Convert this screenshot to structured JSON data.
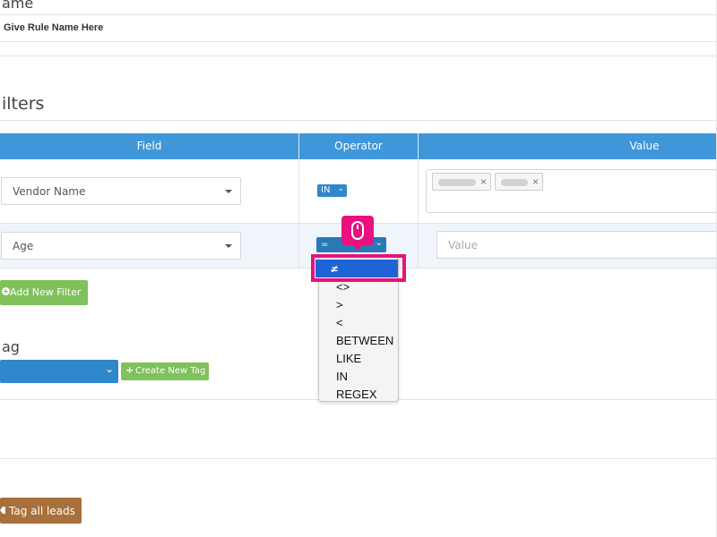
{
  "rule_name": {
    "section_label": "ame",
    "input_value": "Give Rule Name Here"
  },
  "filters": {
    "section_label": "ilters",
    "columns": [
      "Field",
      "Operator",
      "Value"
    ],
    "rows": [
      {
        "field": "Vendor Name",
        "operator": "IN"
      },
      {
        "field": "Age",
        "operator": "=",
        "value_placeholder": "Value"
      }
    ],
    "add_filter_label": "Add New Filter"
  },
  "operator_dropdown": {
    "selected": "=",
    "options": [
      "<>",
      ">",
      "<",
      "BETWEEN",
      "LIKE",
      "IN",
      "REGEX"
    ]
  },
  "tag": {
    "section_label": "ag",
    "create_new_tag_label": "Create New Tag"
  },
  "tag_all_leads_label": "Tag all leads",
  "colors": {
    "header_blue": "#3f97d9",
    "green_button": "#7fc15a",
    "brown_button": "#a8703a",
    "highlight_pink": "#e8117e",
    "selected_blue": "#1f64d6"
  }
}
